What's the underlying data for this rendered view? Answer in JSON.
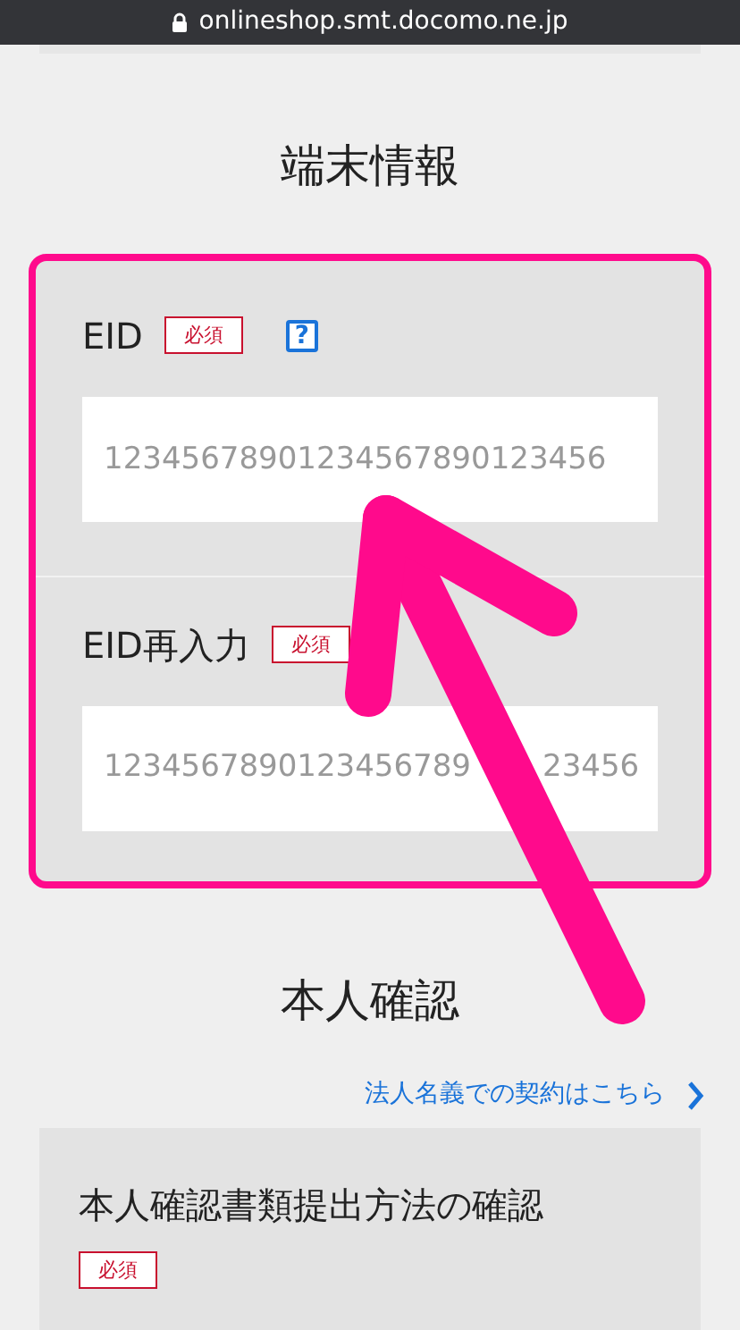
{
  "browser_bar": {
    "url": "onlineshop.smt.docomo.ne.jp"
  },
  "device_section": {
    "title": "端末情報",
    "highlighted": true,
    "fields": [
      {
        "label": "EID",
        "badge": "必須",
        "help": "?",
        "placeholder": "12345678901234567890123456"
      },
      {
        "label": "EID再入力",
        "badge": "必須",
        "placeholder": "1234567890123456789",
        "placeholder_tail": "23456"
      }
    ]
  },
  "identity_section": {
    "title": "本人確認",
    "link": "法人名義での契約はこちら",
    "card": {
      "title": "本人確認書類提出方法の確認",
      "badge": "必須"
    }
  },
  "annotation": {
    "kind": "arrow"
  }
}
